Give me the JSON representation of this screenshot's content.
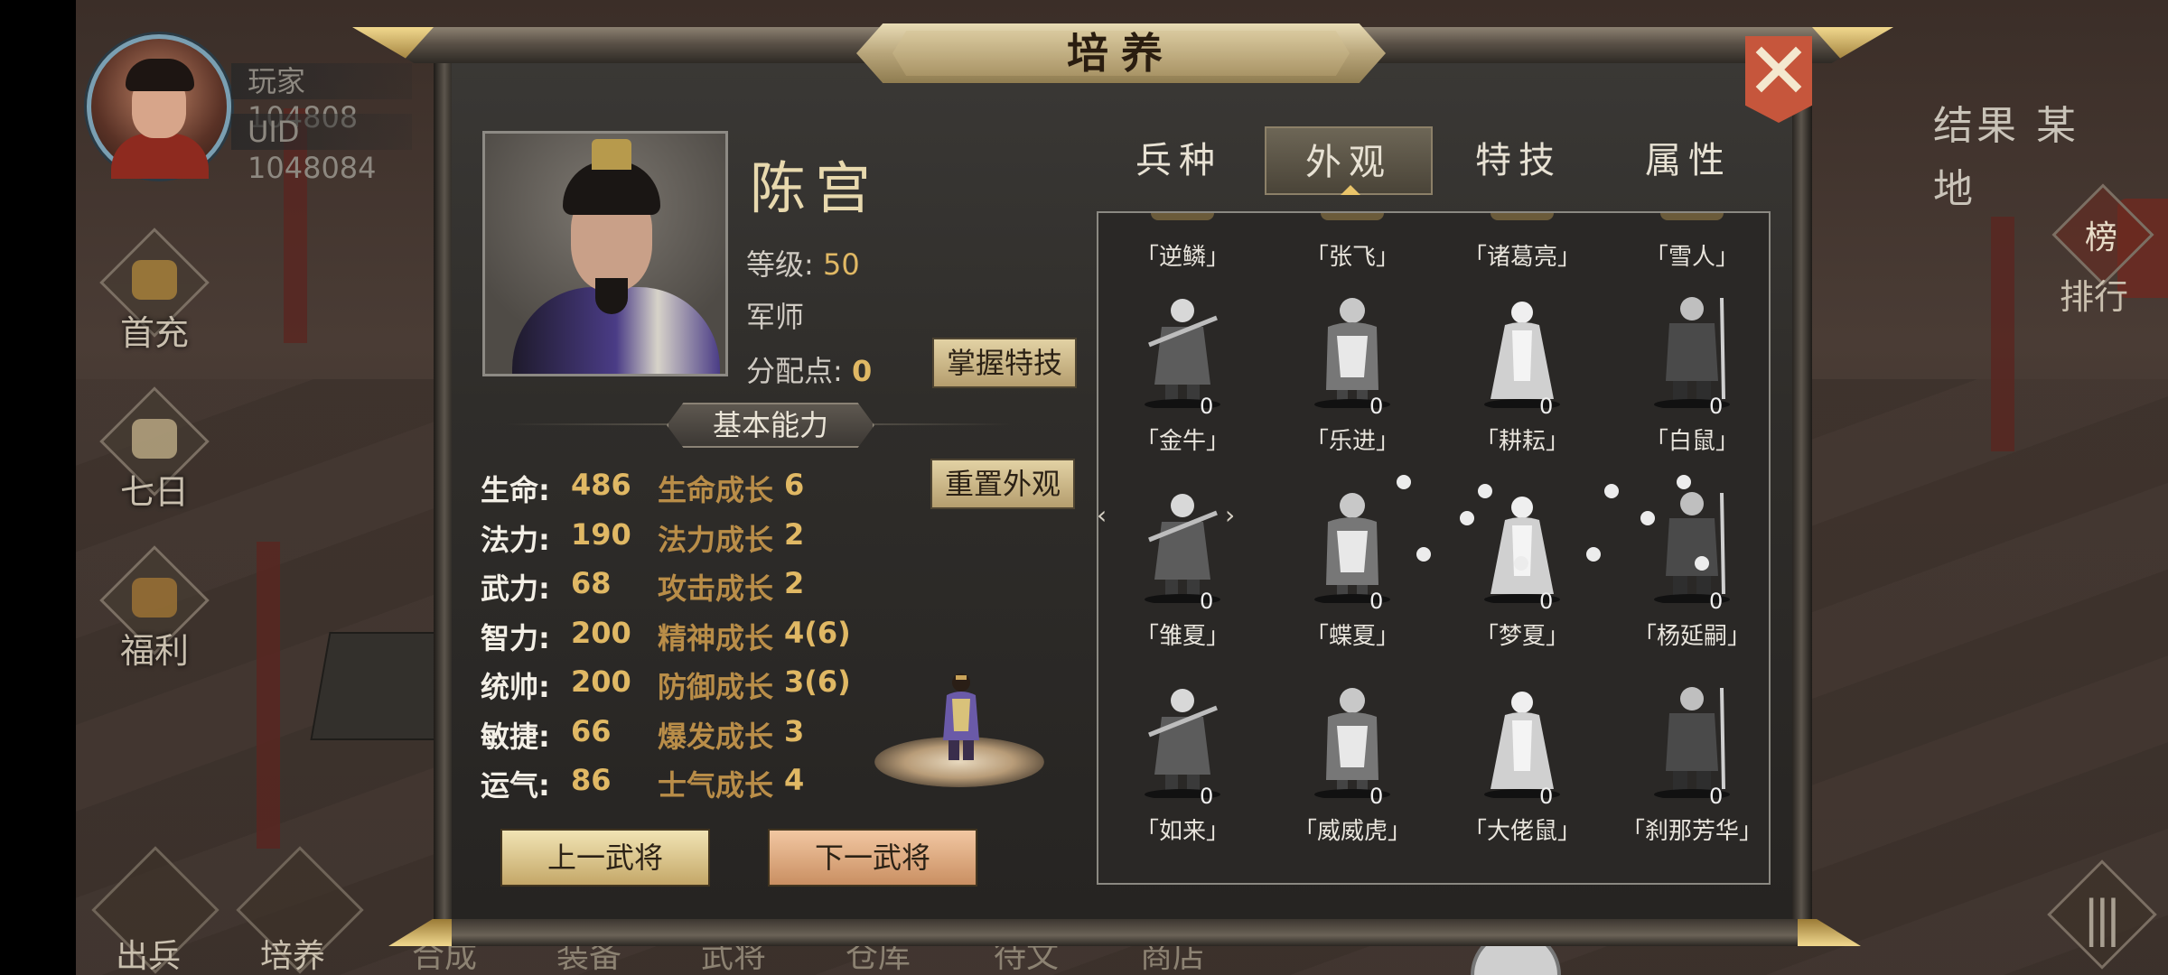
{
  "player": {
    "name": "玩家104808",
    "uid_label": "UID  1048084"
  },
  "side_menu": {
    "items": [
      {
        "label": "首充",
        "icon": "gift-icon"
      },
      {
        "label": "七日",
        "icon": "scroll-icon"
      },
      {
        "label": "福利",
        "icon": "treasure-icon"
      }
    ]
  },
  "bottom_nav": {
    "items": [
      "出兵",
      "培养",
      "合成",
      "装备",
      "武将",
      "仓库",
      "待文",
      "商店"
    ]
  },
  "location": "结果 某地",
  "ranking_label": "排行",
  "ranking_badge": "榜",
  "modal": {
    "title": "培养",
    "close_icon": "close-icon"
  },
  "general": {
    "name": "陈宫",
    "level_label": "等级:",
    "level_value": "50",
    "class": "军师",
    "points_label": "分配点:",
    "points_value": "0"
  },
  "buttons": {
    "master_skill": "掌握特技",
    "reset_look": "重置外观",
    "prev_general": "上一武将",
    "next_general": "下一武将"
  },
  "basic_header": "基本能力",
  "stats": [
    {
      "name": "生命:",
      "value": "486",
      "growth_name": "生命成长",
      "growth_value": "6"
    },
    {
      "name": "法力:",
      "value": "190",
      "growth_name": "法力成长",
      "growth_value": "2"
    },
    {
      "name": "武力:",
      "value": "68",
      "growth_name": "攻击成长",
      "growth_value": "2"
    },
    {
      "name": "智力:",
      "value": "200",
      "growth_name": "精神成长",
      "growth_value": "4(6)"
    },
    {
      "name": "统帅:",
      "value": "200",
      "growth_name": "防御成长",
      "growth_value": "3(6)"
    },
    {
      "name": "敏捷:",
      "value": "66",
      "growth_name": "爆发成长",
      "growth_value": "3"
    },
    {
      "name": "运气:",
      "value": "86",
      "growth_name": "士气成长",
      "growth_value": "4"
    }
  ],
  "tabs": [
    {
      "label": "兵种",
      "active": false
    },
    {
      "label": "外观",
      "active": true
    },
    {
      "label": "特技",
      "active": false
    },
    {
      "label": "属性",
      "active": false
    }
  ],
  "skins_top_row": [
    "「逆鳞」",
    "「张飞」",
    "「诸葛亮」",
    "「雪人」"
  ],
  "skins": [
    {
      "name": "「金牛」",
      "count": "0"
    },
    {
      "name": "「乐进」",
      "count": "0"
    },
    {
      "name": "「耕耘」",
      "count": "0"
    },
    {
      "name": "「白鼠」",
      "count": "0"
    },
    {
      "name": "「雏夏」",
      "count": "0"
    },
    {
      "name": "「蝶夏」",
      "count": "0"
    },
    {
      "name": "「梦夏」",
      "count": "0"
    },
    {
      "name": "「杨延嗣」",
      "count": "0"
    },
    {
      "name": "「如来」",
      "count": "0"
    },
    {
      "name": "「威威虎」",
      "count": "0"
    },
    {
      "name": "「大佬鼠」",
      "count": "0"
    },
    {
      "name": "「刹那芳华」",
      "count": "0"
    }
  ],
  "colors": {
    "gold_text": "#e0b864",
    "growth_label": "#b98d48",
    "close_button": "#c6563c",
    "panel_bg": "#2f2d2a"
  }
}
